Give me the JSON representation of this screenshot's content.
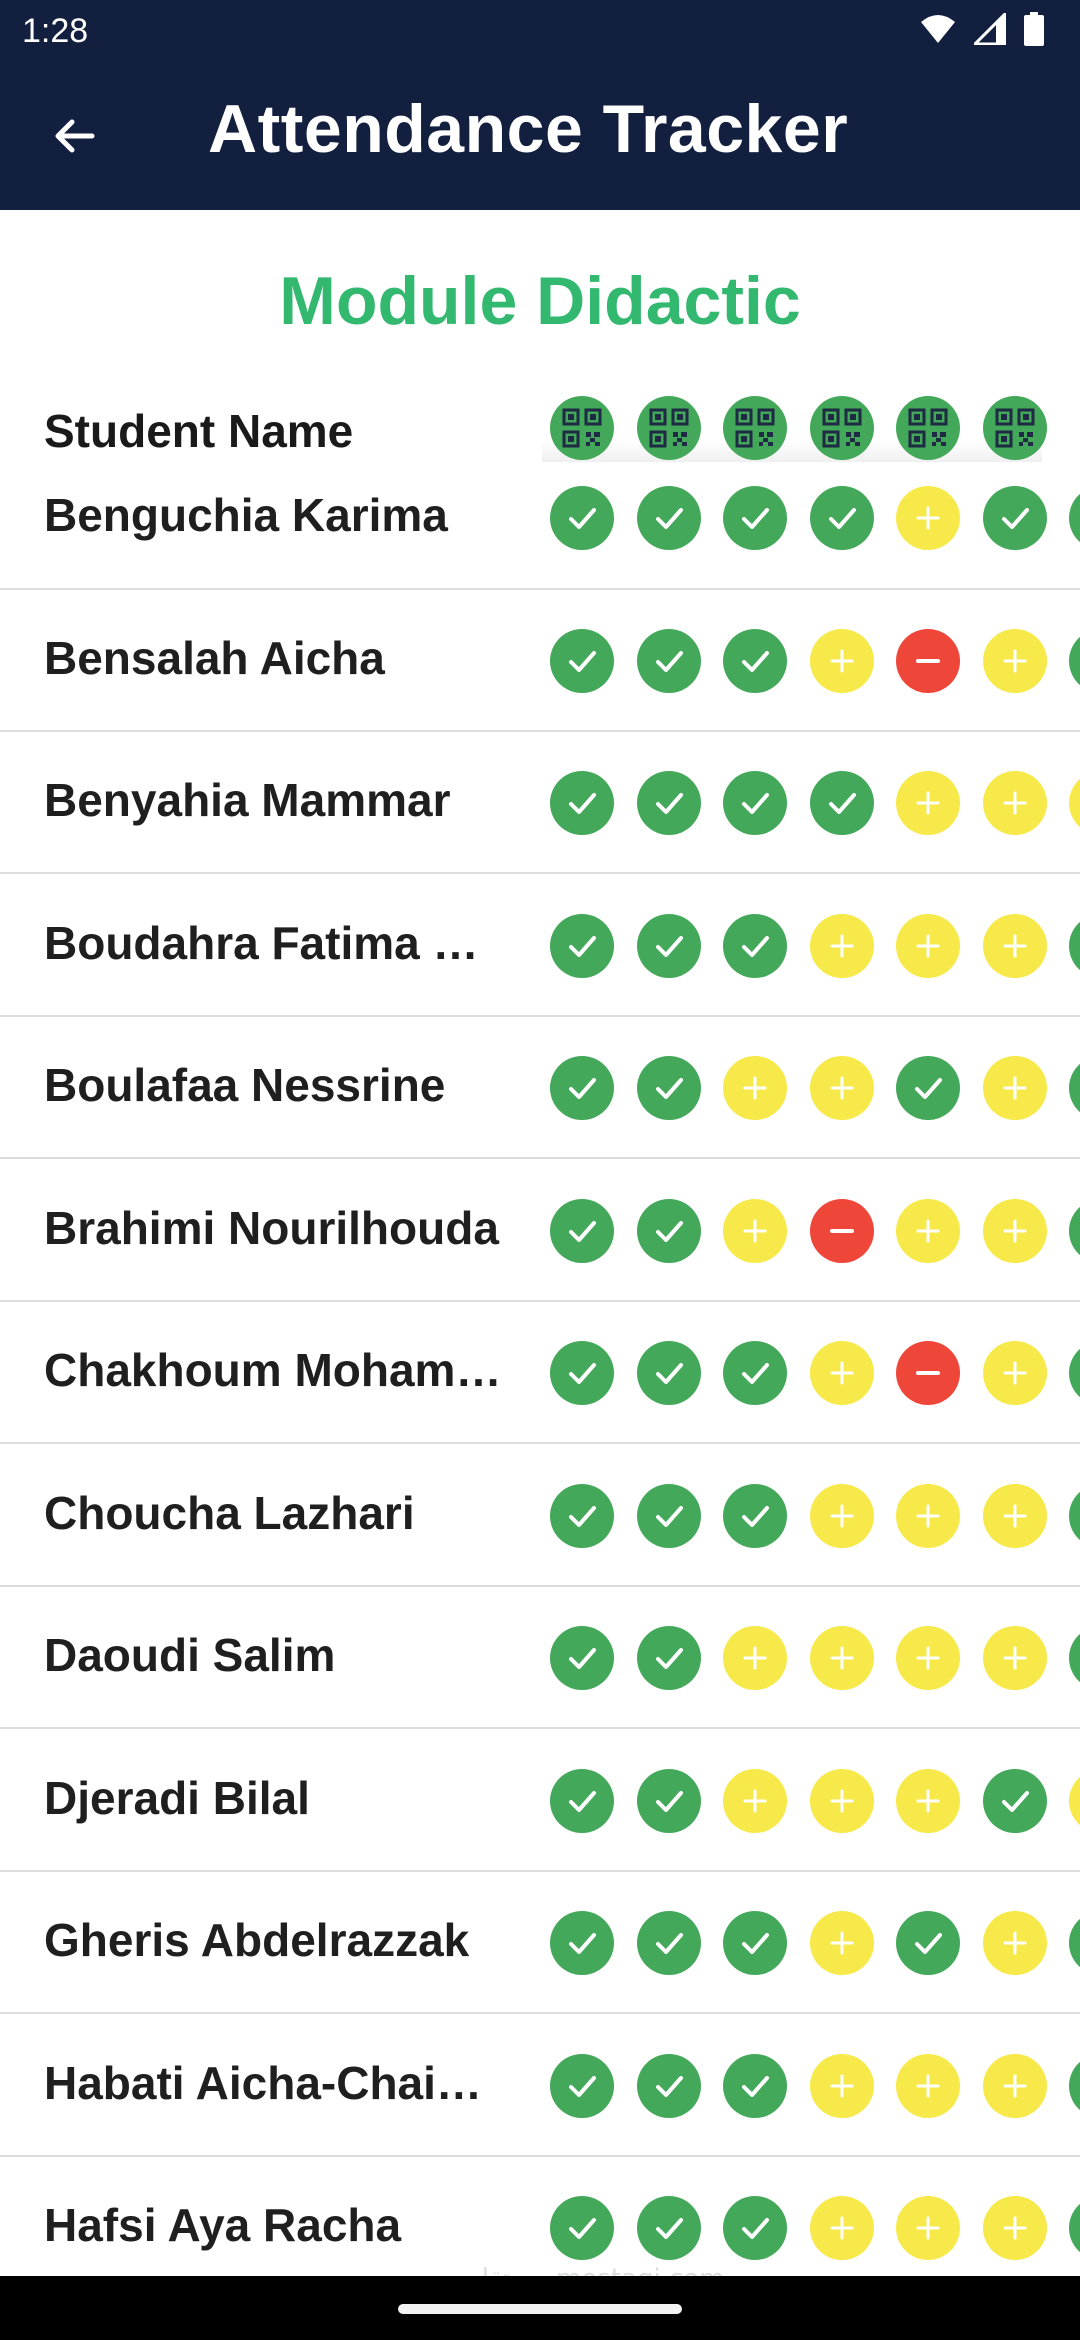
{
  "status_bar": {
    "time": "1:28",
    "icons": [
      "wifi-icon",
      "signal-icon",
      "battery-icon"
    ]
  },
  "app_bar": {
    "title": "Attendance Tracker",
    "back_icon": "arrow-left-icon"
  },
  "module": {
    "title": "Module Didactic"
  },
  "table": {
    "header_label": "Student Name",
    "session_icon": "qr-code-icon",
    "session_count": 6,
    "rows": [
      {
        "name": "Benguchia Karima",
        "marks": [
          "present",
          "present",
          "present",
          "present",
          "late",
          "present",
          "present"
        ]
      },
      {
        "name": "Bensalah Aicha",
        "marks": [
          "present",
          "present",
          "present",
          "late",
          "absent",
          "late",
          "present"
        ]
      },
      {
        "name": "Benyahia Mammar",
        "marks": [
          "present",
          "present",
          "present",
          "present",
          "late",
          "late",
          "late"
        ]
      },
      {
        "name": "Boudahra Fatima Z…",
        "marks": [
          "present",
          "present",
          "present",
          "late",
          "late",
          "late",
          "present"
        ]
      },
      {
        "name": "Boulafaa Nessrine",
        "marks": [
          "present",
          "present",
          "late",
          "late",
          "present",
          "late",
          "present"
        ]
      },
      {
        "name": "Brahimi Nourilhouda",
        "marks": [
          "present",
          "present",
          "late",
          "absent",
          "late",
          "late",
          "present"
        ]
      },
      {
        "name": "Chakhoum Moham…",
        "marks": [
          "present",
          "present",
          "present",
          "late",
          "absent",
          "late",
          "present"
        ]
      },
      {
        "name": "Choucha Lazhari",
        "marks": [
          "present",
          "present",
          "present",
          "late",
          "late",
          "late",
          "present"
        ]
      },
      {
        "name": "Daoudi Salim",
        "marks": [
          "present",
          "present",
          "late",
          "late",
          "late",
          "late",
          "present"
        ]
      },
      {
        "name": "Djeradi Bilal",
        "marks": [
          "present",
          "present",
          "late",
          "late",
          "late",
          "present",
          "late"
        ]
      },
      {
        "name": "Gheris Abdelrazzak",
        "marks": [
          "present",
          "present",
          "present",
          "late",
          "present",
          "late",
          "present"
        ]
      },
      {
        "name": "Habati Aicha-Chai…",
        "marks": [
          "present",
          "present",
          "present",
          "late",
          "late",
          "late",
          "present"
        ]
      },
      {
        "name": "Hafsi Aya Racha",
        "marks": [
          "present",
          "present",
          "present",
          "late",
          "late",
          "late",
          "present"
        ]
      }
    ]
  },
  "colors": {
    "app_bar": "#131f3f",
    "accent": "#33b86f",
    "present": "#43a85a",
    "late": "#f7e94a",
    "absent": "#ef463a"
  },
  "watermark": "مستقل mostaqi.com"
}
